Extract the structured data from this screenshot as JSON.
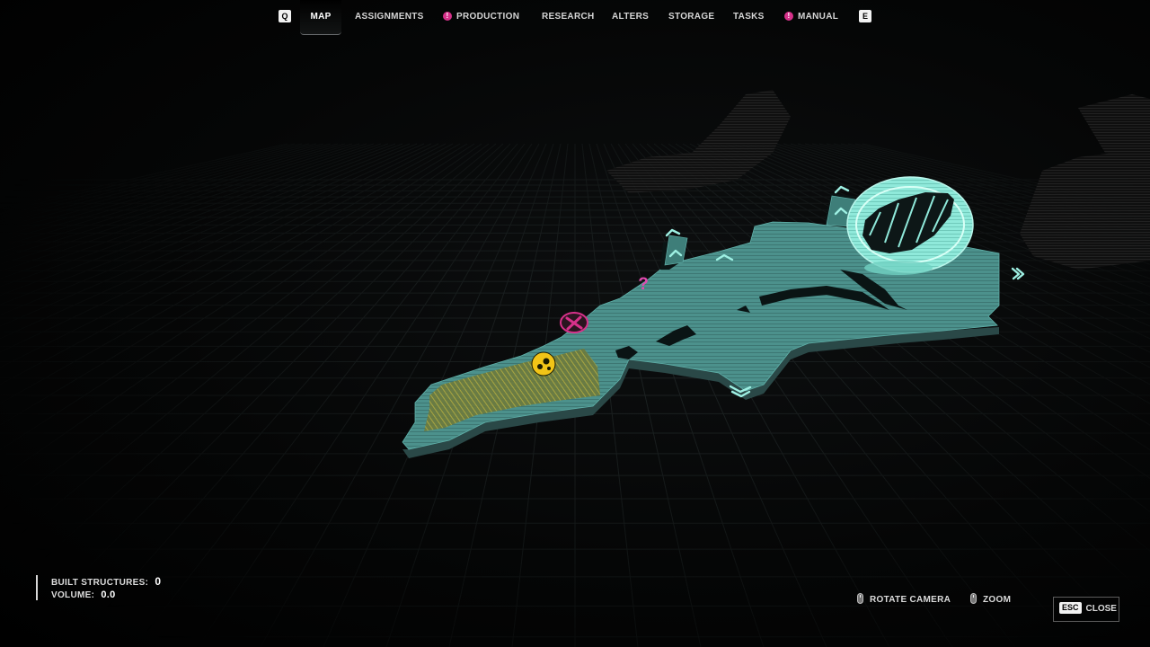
{
  "nav": {
    "prev_key": "Q",
    "next_key": "E",
    "tabs": [
      {
        "label": "MAP",
        "active": true,
        "alert": false
      },
      {
        "label": "ASSIGNMENTS",
        "active": false,
        "alert": false
      },
      {
        "label": "PRODUCTION",
        "active": false,
        "alert": true
      },
      {
        "label": "RESEARCH",
        "active": false,
        "alert": false
      },
      {
        "label": "ALTERS",
        "active": false,
        "alert": false
      },
      {
        "label": "STORAGE",
        "active": false,
        "alert": false
      },
      {
        "label": "TASKS",
        "active": false,
        "alert": false
      },
      {
        "label": "MANUAL",
        "active": false,
        "alert": true
      }
    ],
    "alert_glyph": "!"
  },
  "stats": {
    "built_structures_label": "BUILT STRUCTURES:",
    "built_structures_value": "0",
    "volume_label": "VOLUME:",
    "volume_value": "0.0"
  },
  "controls": {
    "rotate_label": "ROTATE CAMERA",
    "zoom_label": "ZOOM",
    "close_key": "ESC",
    "close_label": "CLOSE"
  },
  "map": {
    "unknown_marker": "?",
    "colors": {
      "land": "#4a8f8a",
      "land_edge": "#2a4847",
      "land_highlight": "#8ce8d8",
      "zone_fill": "#8a8a2e",
      "zone_marker": "#f2c417",
      "alert_marker": "#d6318a",
      "grid": "#1e2424"
    },
    "icons": [
      "crash-site-icon",
      "waypoint-marker-icon",
      "unknown-marker-icon",
      "dome-structure-icon"
    ]
  }
}
